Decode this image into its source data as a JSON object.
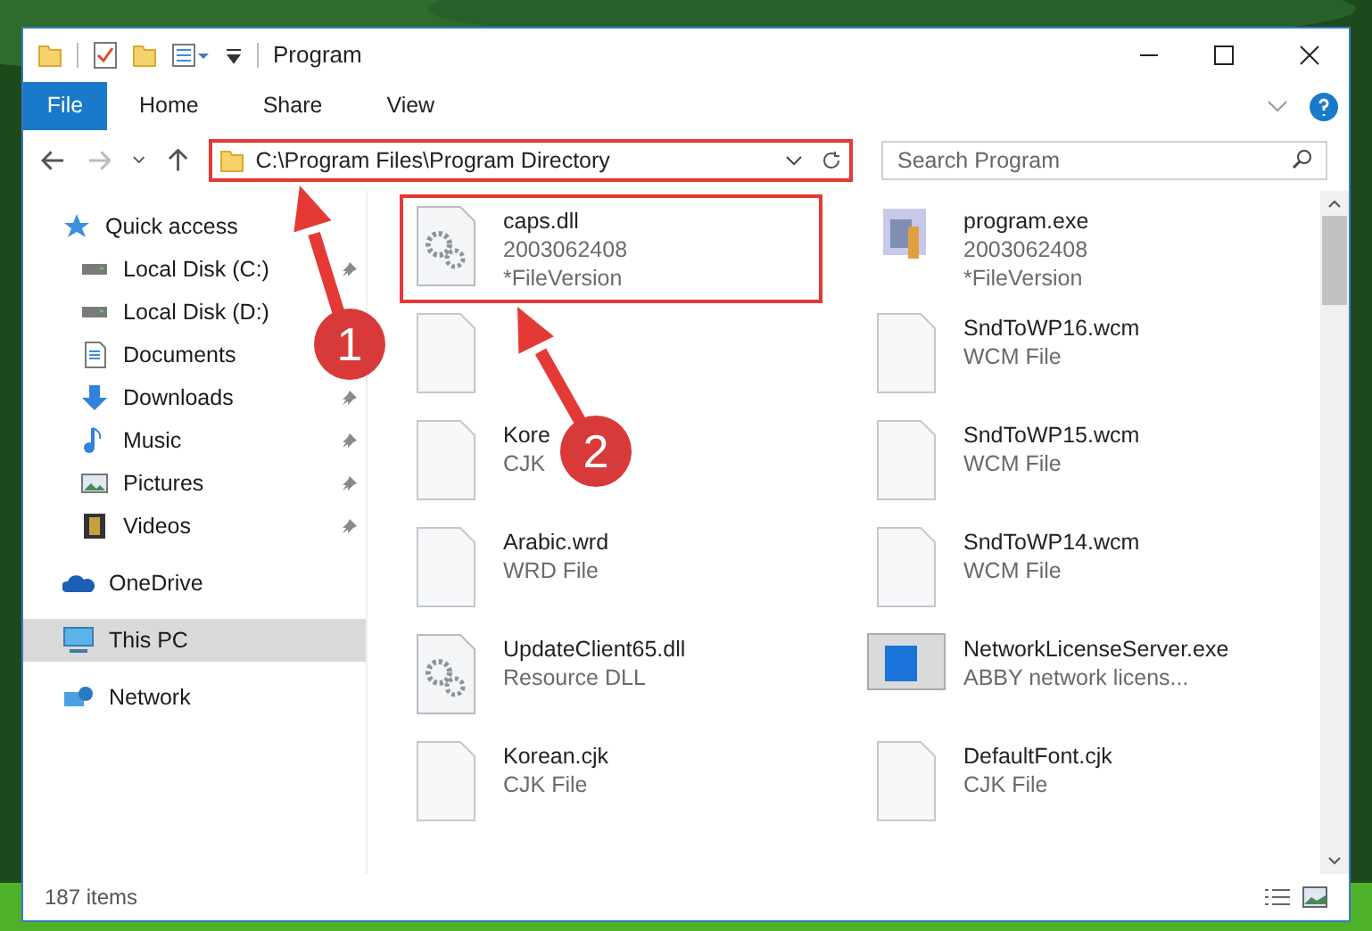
{
  "window": {
    "title": "Program"
  },
  "ribbon_tabs": [
    {
      "label": "File",
      "kind": "file"
    },
    {
      "label": "Home",
      "kind": "tab"
    },
    {
      "label": "Share",
      "kind": "tab"
    },
    {
      "label": "View",
      "kind": "tab"
    }
  ],
  "address": "C:\\Program Files\\Program Directory",
  "search": {
    "placeholder": "Search Program"
  },
  "sidebar": [
    {
      "label": "Quick access",
      "kind": "star",
      "selected": false,
      "children": [
        {
          "label": "Local Disk (C:)",
          "kind": "drive",
          "pinned": true
        },
        {
          "label": "Local Disk (D:)",
          "kind": "drive"
        },
        {
          "label": "Documents",
          "kind": "documents"
        },
        {
          "label": "Downloads",
          "kind": "downloads",
          "pinned": true
        },
        {
          "label": "Music",
          "kind": "music",
          "pinned": true
        },
        {
          "label": "Pictures",
          "kind": "pictures",
          "pinned": true
        },
        {
          "label": "Videos",
          "kind": "videos",
          "pinned": true
        }
      ]
    },
    {
      "label": "OneDrive",
      "kind": "cloud",
      "selected": false
    },
    {
      "label": "This PC",
      "kind": "computer",
      "selected": true
    },
    {
      "label": "Network",
      "kind": "network",
      "selected": false
    }
  ],
  "files": [
    {
      "name": "caps.dll",
      "lines": [
        "2003062408",
        "*FileVersion"
      ],
      "kind": "settings",
      "outlined": true
    },
    {
      "name": "program.exe",
      "lines": [
        "2003062408",
        "*FileVersion"
      ],
      "kind": "program",
      "outlined": false
    },
    {
      "kind": "document",
      "outlined": false
    },
    {
      "name": "SndToWP16.wcm",
      "lines": [
        "WCM File"
      ],
      "kind": "document",
      "outlined": false
    },
    {
      "name": "Kore",
      "lines": [
        "CJK"
      ],
      "kind": "document",
      "outlined": false
    },
    {
      "name": "SndToWP15.wcm",
      "lines": [
        "WCM File"
      ],
      "kind": "document",
      "outlined": false
    },
    {
      "name": "Arabic.wrd",
      "lines": [
        "WRD File"
      ],
      "kind": "document",
      "outlined": false
    },
    {
      "name": "SndToWP14.wcm",
      "lines": [
        "WCM File"
      ],
      "kind": "document",
      "outlined": false
    },
    {
      "name": "UpdateClient65.dll",
      "lines": [
        "Resource DLL"
      ],
      "kind": "settings",
      "outlined": false
    },
    {
      "name": "NetworkLicenseServer.exe",
      "lines": [
        "ABBY network licens..."
      ],
      "kind": "window",
      "outlined": false
    },
    {
      "name": "Korean.cjk",
      "lines": [
        "CJK File"
      ],
      "kind": "document",
      "outlined": false
    },
    {
      "name": "DefaultFont.cjk",
      "lines": [
        "CJK File"
      ],
      "kind": "document",
      "outlined": false
    }
  ],
  "status_bar": {
    "count": "187 items"
  },
  "callouts": [
    {
      "number": "1"
    },
    {
      "number": "2"
    }
  ]
}
